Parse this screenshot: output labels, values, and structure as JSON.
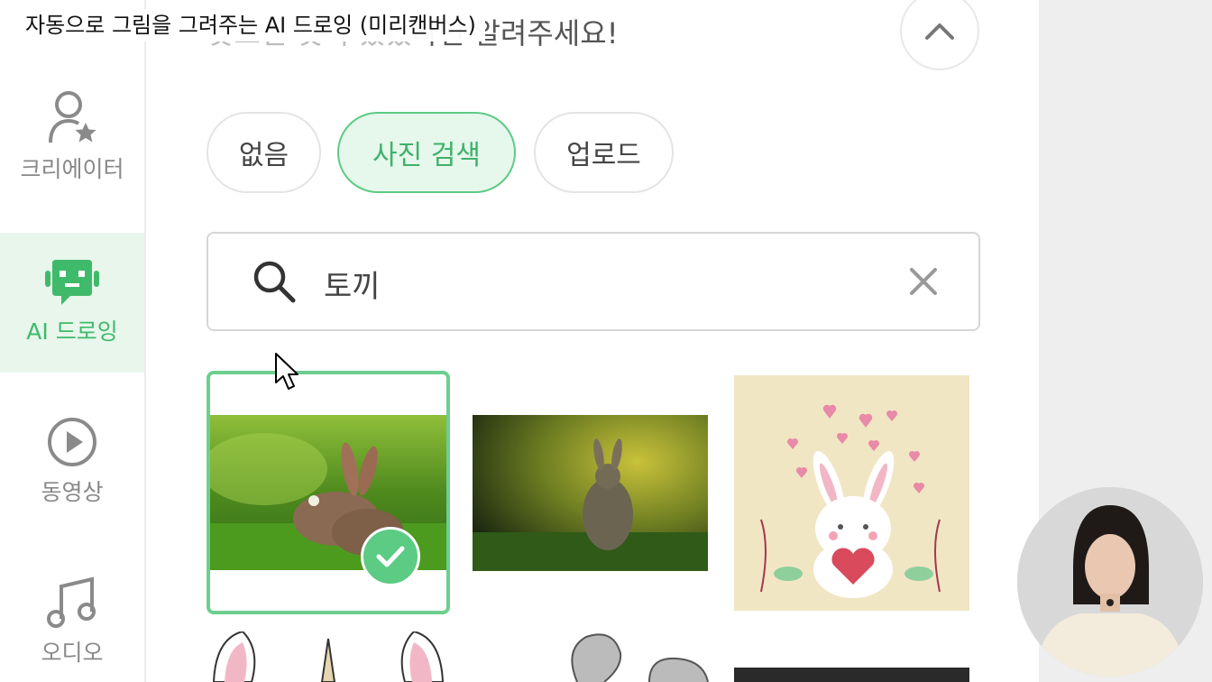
{
  "caption": "자동으로 그림을 그려주는 AI 드로잉 (미리캔버스)",
  "heading": {
    "faded": "찾으신 것이 있었",
    "visible": "다면 알려주세요!"
  },
  "sidebar": {
    "items": [
      {
        "label": "크리에이터",
        "icon": "creator-icon"
      },
      {
        "label": "AI 드로잉",
        "icon": "robot-icon"
      },
      {
        "label": "동영상",
        "icon": "play-icon"
      },
      {
        "label": "오디오",
        "icon": "music-note-icon"
      }
    ]
  },
  "options": {
    "none": "없음",
    "photo_search": "사진 검색",
    "upload": "업로드",
    "selected": "사진 검색"
  },
  "search": {
    "value": "토끼"
  },
  "results": [
    {
      "kind": "photo",
      "subject": "rabbit in grass",
      "selected": true
    },
    {
      "kind": "photo",
      "subject": "rabbit in forest",
      "selected": false
    },
    {
      "kind": "illustration",
      "subject": "white rabbit holding heart",
      "selected": false
    }
  ],
  "colors": {
    "accent": "#5ccb84",
    "accent_text": "#3fb26a",
    "accent_bg": "#e6f7ec"
  }
}
